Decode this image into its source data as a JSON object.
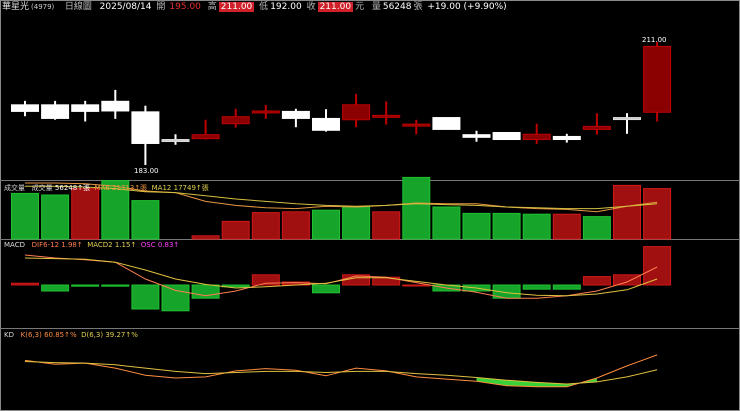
{
  "header": {
    "stock_name": "華星光",
    "stock_code": "(4979)",
    "period": "日線圖",
    "date": "2025/08/14",
    "open_label": "開",
    "open": "195.00",
    "high_label": "高",
    "high": "211.00",
    "low_label": "低",
    "low": "192.00",
    "close_label": "收",
    "close": "211.00",
    "unit": "元",
    "volume_label": "量",
    "volume": "56248",
    "volume_unit": "張",
    "change": "+19.00 (+9.90%)"
  },
  "volume_panel": {
    "title": "成交量",
    "vol_label": "成交量",
    "vol_value": "56248↑張",
    "ma6_label": "MA6",
    "ma6_value": "21713↑張",
    "ma12_label": "MA12",
    "ma12_value": "17749↑張"
  },
  "macd_panel": {
    "title": "MACD",
    "dif_label": "DIF6-12",
    "dif_value": "1.98↑",
    "macd_label": "MACD2",
    "macd_value": "1.15↑",
    "osc_label": "OSC",
    "osc_value": "0.83↑"
  },
  "kd_panel": {
    "title": "KD",
    "k_label": "K(6,3)",
    "k_value": "60.85↑%",
    "d_label": "D(6,3)",
    "d_value": "39.27↑%"
  },
  "price_labels": {
    "max": "211.00",
    "min": "183.00"
  },
  "colors": {
    "up": "#8b0000",
    "up_border": "#c00000",
    "down": "#ffffff",
    "vol_green": "#16a52a",
    "vol_red": "#a01010",
    "ma6": "#e69640",
    "ma12": "#d4c040",
    "dif": "#ff7f50",
    "macd": "#e0c040",
    "osc": "#ff40ff",
    "k": "#ff8c40",
    "d": "#e0c040"
  },
  "chart_data": {
    "type": "candlestick",
    "candles": [
      {
        "o": 196.7,
        "c": 195.2,
        "h": 197.6,
        "l": 194.1
      },
      {
        "o": 196.7,
        "c": 193.6,
        "h": 197.6,
        "l": 193.3
      },
      {
        "o": 196.7,
        "c": 195.2,
        "h": 197.6,
        "l": 192.9
      },
      {
        "o": 197.5,
        "c": 195.3,
        "h": 200.1,
        "l": 193.5
      },
      {
        "o": 195.1,
        "c": 187.9,
        "h": 196.5,
        "l": 183.0
      },
      {
        "o": 188.8,
        "c": 188.8,
        "h": 190.0,
        "l": 187.6
      },
      {
        "o": 189.0,
        "c": 189.9,
        "h": 193.3,
        "l": 188.8
      },
      {
        "o": 192.4,
        "c": 194.0,
        "h": 195.8,
        "l": 191.5
      },
      {
        "o": 195.2,
        "c": 195.3,
        "h": 196.7,
        "l": 193.5
      },
      {
        "o": 195.2,
        "c": 193.6,
        "h": 195.8,
        "l": 191.6
      },
      {
        "o": 193.6,
        "c": 190.9,
        "h": 195.7,
        "l": 190.6
      },
      {
        "o": 193.3,
        "c": 196.7,
        "h": 199.2,
        "l": 191.6
      },
      {
        "o": 194.0,
        "c": 194.3,
        "h": 197.5,
        "l": 192.2
      },
      {
        "o": 192.2,
        "c": 192.3,
        "h": 193.3,
        "l": 190.0
      },
      {
        "o": 193.8,
        "c": 191.1,
        "h": 193.8,
        "l": 191.1
      },
      {
        "o": 189.9,
        "c": 189.3,
        "h": 190.8,
        "l": 188.3
      },
      {
        "o": 190.4,
        "c": 188.8,
        "h": 190.4,
        "l": 188.8
      },
      {
        "o": 188.8,
        "c": 190.0,
        "h": 192.4,
        "l": 187.8
      },
      {
        "o": 189.5,
        "c": 188.8,
        "h": 190.1,
        "l": 188.1
      },
      {
        "o": 191.1,
        "c": 191.8,
        "h": 194.8,
        "l": 189.9
      },
      {
        "o": 193.8,
        "c": 193.8,
        "h": 194.8,
        "l": 190.1
      },
      {
        "o": 195.0,
        "c": 210.0,
        "h": 211.0,
        "l": 192.9
      }
    ],
    "volume": [
      57,
      55,
      63,
      73,
      48,
      0,
      4,
      22,
      33,
      34,
      36,
      40,
      34,
      77,
      40,
      32,
      32,
      31,
      31,
      28,
      67,
      63
    ],
    "volume_color": [
      "g",
      "g",
      "r",
      "g",
      "g",
      "n",
      "r",
      "r",
      "r",
      "r",
      "g",
      "g",
      "r",
      "g",
      "g",
      "g",
      "g",
      "g",
      "r",
      "g",
      "r",
      "r"
    ],
    "ma6": [
      70,
      70,
      69,
      66,
      60,
      58,
      47,
      42,
      39,
      38,
      41,
      40,
      42,
      45,
      44,
      44,
      40,
      38,
      37,
      34,
      41,
      46
    ],
    "ma12": [
      66,
      66,
      65,
      63,
      59,
      58,
      54,
      50,
      47,
      44,
      42,
      41,
      42,
      44,
      43,
      42,
      40,
      39,
      38,
      38,
      41,
      44
    ],
    "osc": [
      0.03,
      -0.1,
      -0.02,
      -0.02,
      -0.4,
      -0.43,
      -0.22,
      -0.03,
      0.17,
      0.05,
      -0.13,
      0.17,
      0.13,
      0.0,
      -0.1,
      -0.1,
      -0.22,
      -0.07,
      -0.07,
      0.14,
      0.17,
      0.64
    ],
    "dif": [
      0.5,
      0.45,
      0.42,
      0.38,
      0.1,
      -0.09,
      -0.18,
      -0.1,
      0.03,
      0.04,
      0.02,
      0.15,
      0.13,
      0.04,
      -0.05,
      -0.12,
      -0.22,
      -0.22,
      -0.18,
      -0.1,
      0.05,
      0.3
    ],
    "macd": [
      0.45,
      0.44,
      0.43,
      0.38,
      0.25,
      0.1,
      0.01,
      -0.05,
      -0.03,
      0.0,
      0.03,
      0.12,
      0.12,
      0.06,
      0.0,
      -0.05,
      -0.13,
      -0.17,
      -0.18,
      -0.15,
      -0.08,
      0.1
    ],
    "k": [
      72,
      65,
      67,
      58,
      45,
      40,
      42,
      53,
      57,
      54,
      44,
      58,
      53,
      42,
      38,
      34,
      26,
      24,
      24,
      40,
      62,
      82
    ],
    "d": [
      70,
      68,
      67,
      64,
      58,
      52,
      48,
      50,
      52,
      52,
      50,
      52,
      52,
      48,
      45,
      41,
      36,
      32,
      29,
      33,
      42,
      55
    ]
  }
}
